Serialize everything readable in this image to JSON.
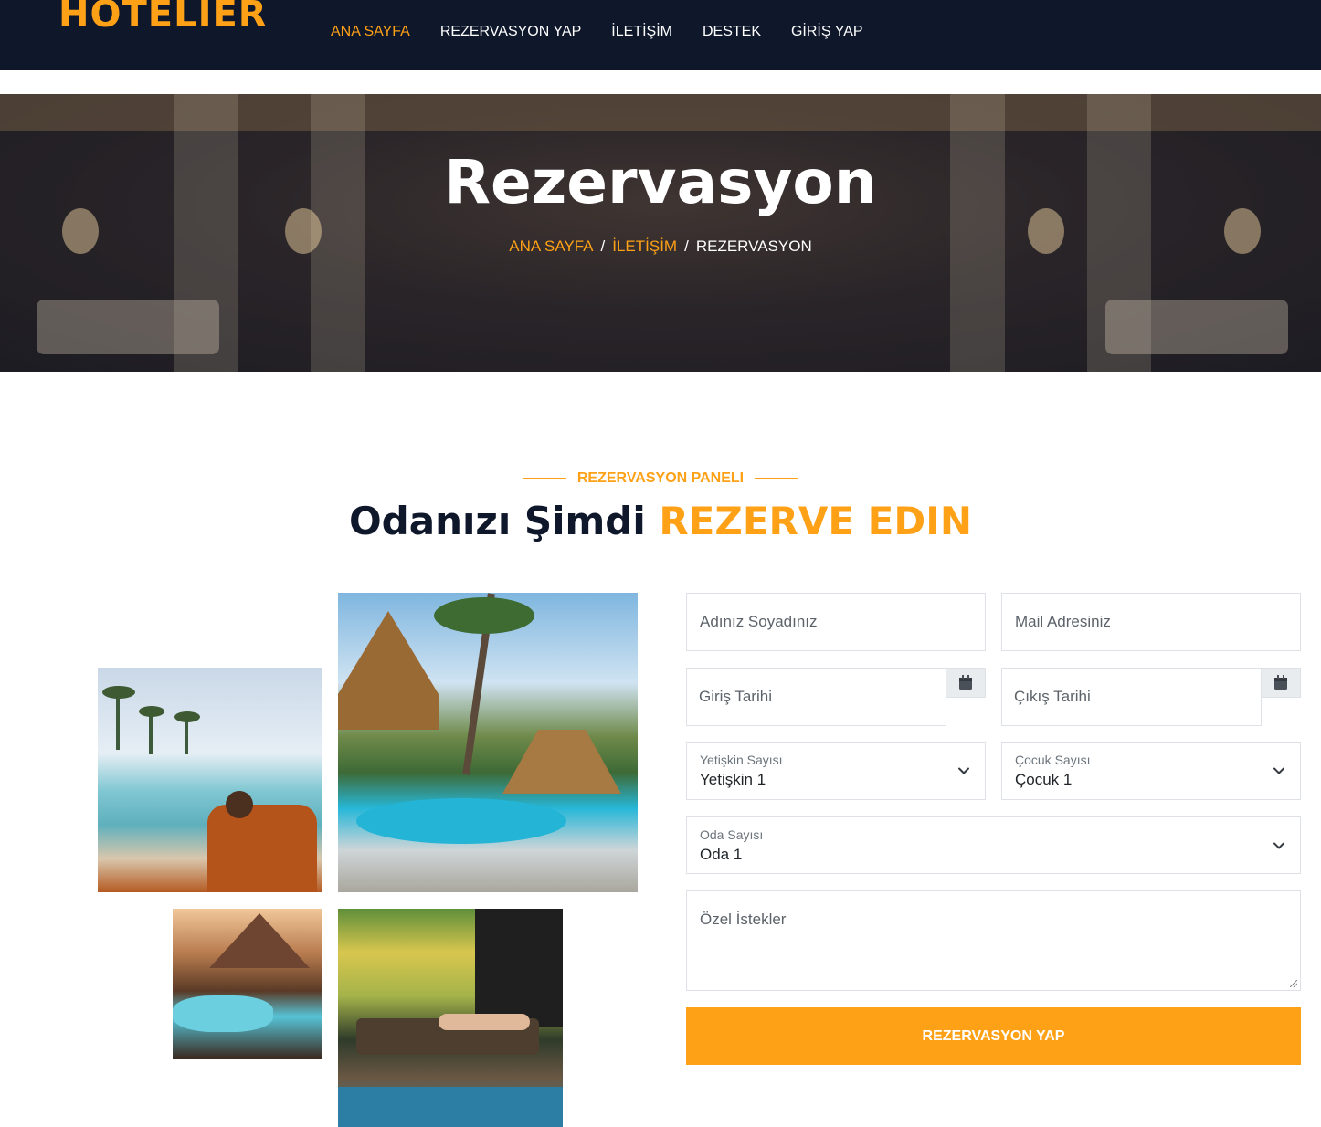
{
  "brand": {
    "logo": "HOTELIER",
    "accent_color": "#fea116",
    "dark_color": "#0f172b"
  },
  "nav": {
    "items": [
      {
        "label": "ANA SAYFA",
        "active": true
      },
      {
        "label": "REZERVASYON YAP",
        "active": false
      },
      {
        "label": "İLETİŞİM",
        "active": false
      },
      {
        "label": "DESTEK",
        "active": false
      },
      {
        "label": "GİRİŞ YAP",
        "active": false
      }
    ]
  },
  "hero": {
    "title": "Rezervasyon",
    "breadcrumb": [
      {
        "label": "ANA SAYFA"
      },
      {
        "label": "İLETİŞİM"
      },
      {
        "label": "REZERVASYON"
      }
    ],
    "separator": "/"
  },
  "section": {
    "subtitle": "REZERVASYON PANELI",
    "heading_main": "Odanızı Şimdi ",
    "heading_accent": "REZERVE EDIN"
  },
  "form": {
    "name_placeholder": "Adınız Soyadınız",
    "mail_placeholder": "Mail Adresiniz",
    "checkin_placeholder": "Giriş Tarihi",
    "checkout_placeholder": "Çıkış Tarihi",
    "adults": {
      "label": "Yetişkin Sayısı",
      "value": "Yetişkin 1"
    },
    "children": {
      "label": "Çocuk Sayısı",
      "value": "Çocuk 1"
    },
    "rooms": {
      "label": "Oda Sayısı",
      "value": "Oda 1"
    },
    "requests_placeholder": "Özel İstekler",
    "submit_label": "REZERVASYON YAP"
  },
  "icons": [
    "calendar-icon",
    "chevron-down-icon"
  ]
}
